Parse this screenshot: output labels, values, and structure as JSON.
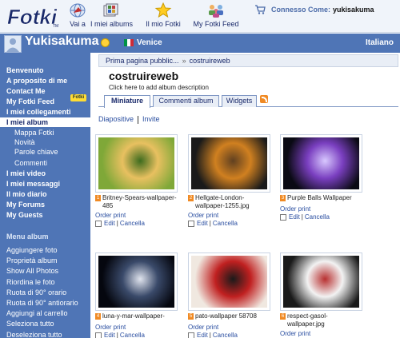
{
  "nav": {
    "logo_text": "Fotki",
    "items": [
      {
        "label": "Vai a",
        "icon": "globe-icon"
      },
      {
        "label": "I miei albums",
        "icon": "albums-icon"
      },
      {
        "label": "Il mio Fotki",
        "icon": "star-icon"
      },
      {
        "label": "My Fotki Feed",
        "icon": "people-icon"
      }
    ],
    "cart_icon": "cart-icon",
    "connesso_label": "Connesso Come:",
    "connesso_user": "yukisakuma"
  },
  "banner": {
    "username": "Yukisakuma",
    "city": "Venice",
    "language": "Italiano",
    "flag_colors": [
      "#009246",
      "#ffffff",
      "#ce2b37"
    ]
  },
  "sidebar": {
    "items": [
      {
        "label": "Benvenuto",
        "type": "main"
      },
      {
        "label": "A proposito di me",
        "type": "main"
      },
      {
        "label": "Contact Me",
        "type": "main"
      },
      {
        "label": "My Fotki Feed",
        "type": "main"
      },
      {
        "label": "I miei collegamenti",
        "type": "main"
      },
      {
        "label": "I miei album",
        "type": "active"
      },
      {
        "label": "Mappa Fotki",
        "type": "sub"
      },
      {
        "label": "Novità",
        "type": "sub"
      },
      {
        "label": "Parole chiave",
        "type": "sub"
      },
      {
        "label": "Commenti",
        "type": "sub"
      },
      {
        "label": "I miei video",
        "type": "main"
      },
      {
        "label": "I miei messaggi",
        "type": "main"
      },
      {
        "label": "Il mio diario",
        "type": "main"
      },
      {
        "label": "My Forums",
        "type": "main"
      },
      {
        "label": "My Guests",
        "type": "main"
      }
    ],
    "badge": "Fotki",
    "menu_heading": "Menu album",
    "menu_items": [
      "Aggiungere foto",
      "Proprietà album",
      "Show All Photos",
      "Riordina le foto",
      "Ruota di 90° orario",
      "Ruota di 90° antiorario",
      "Aggiungi al carrello",
      "Seleziona tutto",
      "Deseleziona tutto"
    ]
  },
  "breadcrumb": {
    "first": "Prima pagina pubblic...",
    "separator": "»",
    "current": "costruireweb"
  },
  "album": {
    "title": "costruireweb",
    "description_prompt": "Click here to add album description"
  },
  "tabs": [
    "Miniature",
    "Commenti album",
    "Widgets"
  ],
  "view_links": [
    "Diapositive",
    "Invite"
  ],
  "photo_actions": {
    "order": "Order print",
    "edit": "Edit",
    "delete": "Cancella"
  },
  "photos": [
    {
      "number": "1",
      "title": "Britney-Spears-wallpaper-485",
      "palette": [
        "#7fa838",
        "#e8c060",
        "#3d6b1e"
      ]
    },
    {
      "number": "2",
      "title": "Hellgate-London-wallpaper-1255.jpg",
      "palette": [
        "#1a1a1a",
        "#d08020",
        "#604020"
      ]
    },
    {
      "number": "3",
      "title": "Purple Balls Wallpaper",
      "palette": [
        "#0a0a14",
        "#7a3fc0",
        "#d8c8ff"
      ]
    },
    {
      "number": "4",
      "title": "luna-y-mar-wallpaper-",
      "palette": [
        "#05070f",
        "#3a4a6a",
        "#e0e4ee"
      ]
    },
    {
      "number": "5",
      "title": "pato-wallpaper 58708",
      "palette": [
        "#f0e8e0",
        "#c02020",
        "#1a1a1a"
      ]
    },
    {
      "number": "6",
      "title": "respect-gasol-wallpaper.jpg",
      "palette": [
        "#1a1a1a",
        "#f2f2f2",
        "#b83030"
      ]
    }
  ]
}
